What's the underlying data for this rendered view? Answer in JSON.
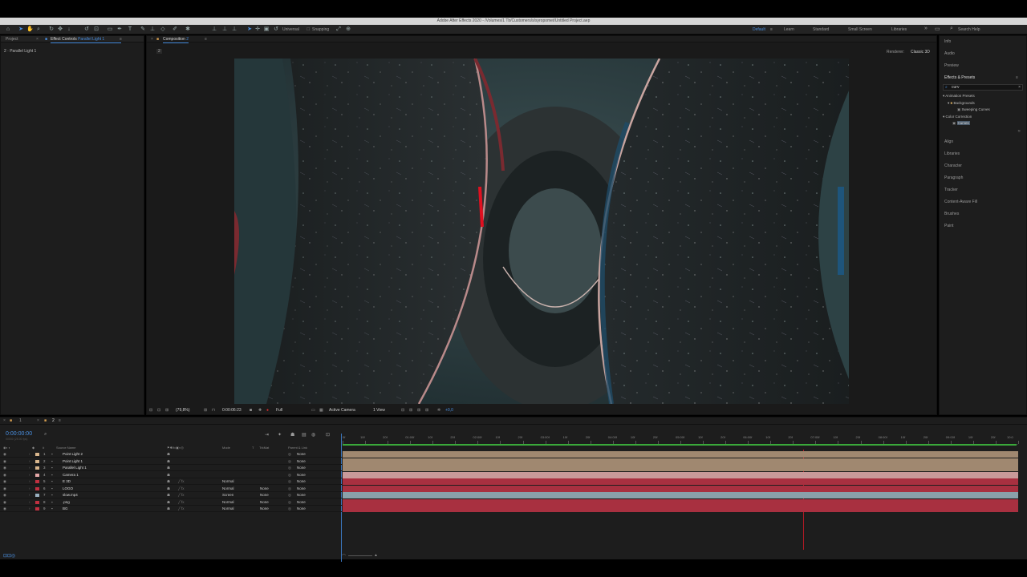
{
  "window": {
    "title": "Adobe After Effects 2020 - /Volumes/1 Tb/Customers/s/syropomet/Untitled Project.aep"
  },
  "toolbar": {
    "snapping_label": "Snapping",
    "universal_label": "Universal",
    "workspaces": [
      "Default",
      "Learn",
      "Standard",
      "Small Screen",
      "Libraries"
    ],
    "active_workspace": "Default",
    "search_help_placeholder": "Search Help"
  },
  "left_panel": {
    "tabs": [
      "Project",
      "Effect Controls",
      "Parallel Light 1"
    ],
    "subtitle": "2 · Parallel Light 1"
  },
  "composition": {
    "tab_label": "Composition",
    "tab_name": "2",
    "flow_label": "2",
    "renderer_label": "Renderer:",
    "renderer_value": "Classic 3D",
    "zoom": "(79,8%)",
    "timecode": "0:00:06:23",
    "resolution": "Full",
    "camera": "Active Camera",
    "views": "1 View",
    "exposure": "+0,0"
  },
  "right_panel": {
    "items": [
      "Info",
      "Audio",
      "Preview",
      "Effects & Presets"
    ],
    "search_value": "curv",
    "tree": [
      {
        "label": "Animation Presets",
        "level": 0
      },
      {
        "label": "Backgrounds",
        "level": 1
      },
      {
        "label": "Sweeping Curves",
        "level": 2
      },
      {
        "label": "Color Correction",
        "level": 0
      },
      {
        "label": "Curves",
        "level": 1
      }
    ],
    "lower_items": [
      "Align",
      "Libraries",
      "Character",
      "Paragraph",
      "Tracker",
      "Content-Aware Fill",
      "Brushes",
      "Paint"
    ]
  },
  "timeline": {
    "tabs": [
      "1",
      "2"
    ],
    "current_time": "0:00:00:00",
    "sub_time": "00000 (25.00 fps)",
    "columns": {
      "source": "Source Name",
      "mode": "Mode",
      "t": "T",
      "trkmat": "TrkMat",
      "parent": "Parent & Link"
    },
    "ruler": [
      "0f",
      "10f",
      "20f",
      "01:00f",
      "10f",
      "20f",
      "02:00f",
      "10f",
      "20f",
      "03:00f",
      "10f",
      "20f",
      "04:00f",
      "10f",
      "20f",
      "05:00f",
      "10f",
      "20f",
      "06:00f",
      "10f",
      "20f",
      "07:00f",
      "10f",
      "20f",
      "08:00f",
      "10f",
      "20f",
      "09:00f",
      "10f",
      "20f",
      "10:0"
    ],
    "layers": [
      {
        "num": "1",
        "name": "Point Light 2",
        "mode": "",
        "trkmat": "",
        "parent": "None",
        "color": "#d9b68c",
        "bar": "#a08870"
      },
      {
        "num": "2",
        "name": "Point Light 1",
        "mode": "",
        "trkmat": "",
        "parent": "None",
        "color": "#d9b68c",
        "bar": "#a08870"
      },
      {
        "num": "3",
        "name": "Parallel Light 1",
        "mode": "",
        "trkmat": "",
        "parent": "None",
        "color": "#d9b68c",
        "bar": "#a08870"
      },
      {
        "num": "4",
        "name": "Camera 1",
        "mode": "",
        "trkmat": "",
        "parent": "None",
        "color": "#e6a8a8",
        "bar": "#c89a9a"
      },
      {
        "num": "5",
        "name": "E 3D",
        "mode": "Normal",
        "trkmat": "",
        "parent": "None",
        "color": "#c03040",
        "bar": "#a83040"
      },
      {
        "num": "6",
        "name": "LOGO",
        "mode": "Normal",
        "trkmat": "None",
        "parent": "None",
        "color": "#c03040",
        "bar": "#a83040"
      },
      {
        "num": "7",
        "name": "slow.mp4",
        "mode": "Screen",
        "trkmat": "None",
        "parent": "None",
        "color": "#9ab0c0",
        "bar": "#8aa0aa"
      },
      {
        "num": "8",
        "name": ".png",
        "mode": "Normal",
        "trkmat": "None",
        "parent": "None",
        "color": "#c03040",
        "bar": "#a83040"
      },
      {
        "num": "9",
        "name": "BG",
        "mode": "Normal",
        "trkmat": "None",
        "parent": "None",
        "color": "#c03040",
        "bar": "#a83040"
      }
    ]
  }
}
